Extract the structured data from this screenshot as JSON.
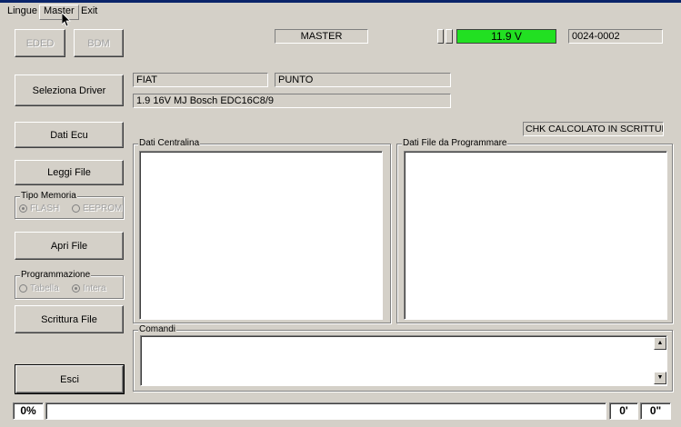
{
  "menu": {
    "items": [
      "Lingue",
      "Master",
      "Exit"
    ]
  },
  "buttons": {
    "eded": "EDED",
    "bdm": "BDM",
    "seleziona_driver": "Seleziona Driver",
    "dati_ecu": "Dati Ecu",
    "leggi_file": "Leggi File",
    "apri_file": "Apri File",
    "scrittura_file": "Scrittura File",
    "esci": "Esci"
  },
  "header": {
    "mode": "MASTER",
    "voltage": "11.9 V",
    "serial": "0024-0002"
  },
  "vehicle": {
    "brand": "FIAT",
    "model": "PUNTO",
    "engine": "1.9  16V  MJ Bosch EDC16C8/9"
  },
  "chk_label": "CHK CALCOLATO IN SCRITTURA",
  "tipo_memoria": {
    "label": "Tipo Memoria",
    "options": [
      "FLASH",
      "EEPROM"
    ],
    "selected": "FLASH"
  },
  "programmazione": {
    "label": "Programmazione",
    "options": [
      "Tabella",
      "Intera"
    ],
    "selected": "Intera"
  },
  "panels": {
    "dati_centralina": "Dati Centralina",
    "dati_file": "Dati File da Programmare",
    "comandi": "Comandi"
  },
  "status": {
    "progress": "0%",
    "minutes": "0'",
    "seconds": "0\""
  },
  "colors": {
    "voltage_bg": "#22e022",
    "titlebar": "#0a246a"
  }
}
